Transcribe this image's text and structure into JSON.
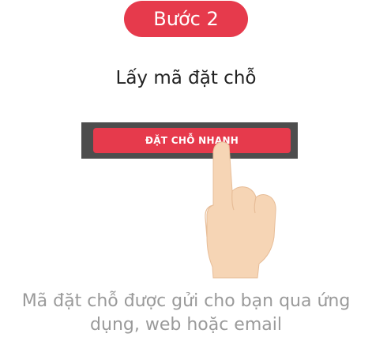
{
  "step": {
    "badge_label": "Bước 2",
    "title": "Lấy mã đặt chỗ"
  },
  "illustration": {
    "button_label": "ĐẶT CHỖ NHANH",
    "hand_icon": "pointing-hand-icon"
  },
  "caption": {
    "line1": "Mã đặt chỗ được gửi cho bạn qua ứng",
    "line2": "dụng, web hoặc email"
  },
  "colors": {
    "accent": "#e63a4c",
    "bar": "#4d4d4d",
    "skin": "#f6d5b5",
    "caption": "#9a9a9a"
  }
}
